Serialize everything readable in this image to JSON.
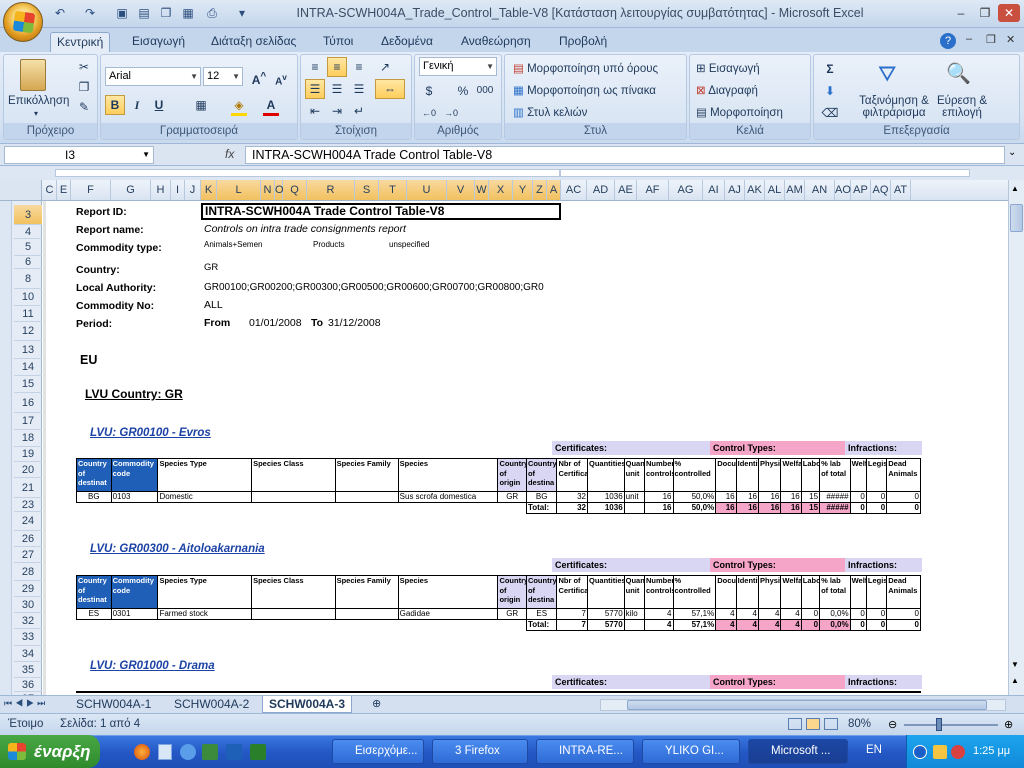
{
  "window": {
    "title": "INTRA-SCWH004A_Trade_Control_Table-V8  [Κατάσταση λειτουργίας συμβατότητας] - Microsoft Excel"
  },
  "ribbon": {
    "tabs": [
      "Κεντρική",
      "Εισαγωγή",
      "Διάταξη σελίδας",
      "Τύποι",
      "Δεδομένα",
      "Αναθεώρηση",
      "Προβολή"
    ],
    "clipboard": {
      "paste": "Επικόλληση",
      "label": "Πρόχειρο"
    },
    "font": {
      "name": "Arial",
      "size": "12",
      "label": "Γραμματοσειρά"
    },
    "alignment": {
      "label": "Στοίχιση"
    },
    "number": {
      "format": "Γενική",
      "label": "Αριθμός",
      "percent": "%",
      "thousands": "000"
    },
    "styles": {
      "conditional": "Μορφοποίηση υπό όρους",
      "table": "Μορφοποίηση ως πίνακα",
      "cell": "Στυλ κελιών",
      "label": "Στυλ"
    },
    "cells": {
      "insert": "Εισαγωγή",
      "delete": "Διαγραφή",
      "format": "Μορφοποίηση",
      "label": "Κελιά"
    },
    "editing": {
      "sort": "Ταξινόμηση &",
      "sort2": "φιλτράρισμα",
      "find": "Εύρεση &",
      "find2": "επιλογή",
      "label": "Επεξεργασία"
    }
  },
  "formula": {
    "namebox": "I3",
    "fx": "fx",
    "content": "INTRA-SCWH004A Trade Control Table-V8"
  },
  "columns": [
    "C",
    "E",
    "F",
    "G",
    "H",
    "I",
    "J",
    "K",
    "L",
    "N",
    "O",
    "Q",
    "R",
    "S",
    "T",
    "U",
    "V",
    "W",
    "X",
    "Y",
    "Z",
    "A",
    "AC",
    "AD",
    "AE",
    "AF",
    "AG",
    "AI",
    "AJ",
    "AK",
    "AL",
    "AM",
    "AN",
    "AO",
    "AP",
    "AQ",
    "AT"
  ],
  "rows": [
    "3",
    "4",
    "5",
    "6",
    "8",
    "10",
    "11",
    "12",
    "13",
    "14",
    "15",
    "16",
    "17",
    "18",
    "19",
    "20",
    "21",
    "23",
    "24",
    "26",
    "27",
    "28",
    "29",
    "30",
    "32",
    "33",
    "34",
    "35",
    "36",
    "37"
  ],
  "report": {
    "id_label": "Report ID:",
    "id": "INTRA-SCWH004A Trade Control Table-V8",
    "name_label": "Report name:",
    "name": "Controls on intra trade consignments report",
    "commodity_type_label": "Commodity type:",
    "ct1": "Animals+Semen",
    "ct2": "Products",
    "ct3": "unspecified",
    "country_label": "Country:",
    "country": "GR",
    "local_authority_label": "Local Authority:",
    "local_authority": "GR00100;GR00200;GR00300;GR00500;GR00600;GR00700;GR00800;GR0",
    "commodity_no_label": "Commodity No:",
    "commodity_no": "ALL",
    "period_label": "Period:",
    "from_label": "From",
    "from": "01/01/2008",
    "to_label": "To",
    "to": "31/12/2008",
    "eu": "EU",
    "lvu_country": "LVU Country: GR"
  },
  "bands": {
    "certificates": "Certificates:",
    "control_types": "Control Types:",
    "infractions": "Infractions:"
  },
  "headers": [
    "Country of destinat",
    "Commodity code",
    "Species Type",
    "Species Class",
    "Species Family",
    "Species",
    "Country of origin",
    "Country of destina",
    "Nbr of Certificates",
    "Quantities",
    "Quantity unit",
    "Number controls",
    "% controlled",
    "Document",
    "Identification",
    "Physical",
    "Welfare",
    "Laboratory",
    "% lab of total",
    "Welf",
    "Legis",
    "Dead Animals"
  ],
  "sections": [
    {
      "title": "LVU: GR00100 - Evros",
      "row": [
        "BG",
        "0103",
        "Domestic",
        "",
        "",
        "Sus scrofa domestica",
        "GR",
        "BG",
        "32",
        "1036",
        "unit",
        "16",
        "50,0%",
        "16",
        "16",
        "16",
        "16",
        "15",
        "#####",
        "0",
        "0",
        "0"
      ],
      "total": [
        "Total:",
        "32",
        "1036",
        "",
        "16",
        "50,0%",
        "16",
        "16",
        "16",
        "16",
        "15",
        "#####",
        "0",
        "0",
        "0"
      ]
    },
    {
      "title": "LVU: GR00300 - Aitoloakarnania",
      "row": [
        "ES",
        "0301",
        "Farmed stock",
        "",
        "",
        "Gadidae",
        "GR",
        "ES",
        "7",
        "5770",
        "kilo",
        "4",
        "57,1%",
        "4",
        "4",
        "4",
        "4",
        "0",
        "0,0%",
        "0",
        "0",
        "0"
      ],
      "total": [
        "Total:",
        "7",
        "5770",
        "",
        "4",
        "57,1%",
        "4",
        "4",
        "4",
        "4",
        "0",
        "0,0%",
        "0",
        "0",
        "0"
      ]
    },
    {
      "title": "LVU: GR01000 - Drama"
    }
  ],
  "sheet_tabs": [
    "SCHW004A-1",
    "SCHW004A-2",
    "SCHW004A-3"
  ],
  "status": {
    "ready": "Έτοιμο",
    "page": "Σελίδα: 1 από 4",
    "zoom": "80%"
  },
  "taskbar": {
    "start": "έναρξη",
    "items": [
      "Εισερχόμε...",
      "3 Firefox",
      "INTRA-RE...",
      "YLIKO GI...",
      "Microsoft ..."
    ],
    "lang": "EN",
    "clock": "1:25 μμ"
  }
}
